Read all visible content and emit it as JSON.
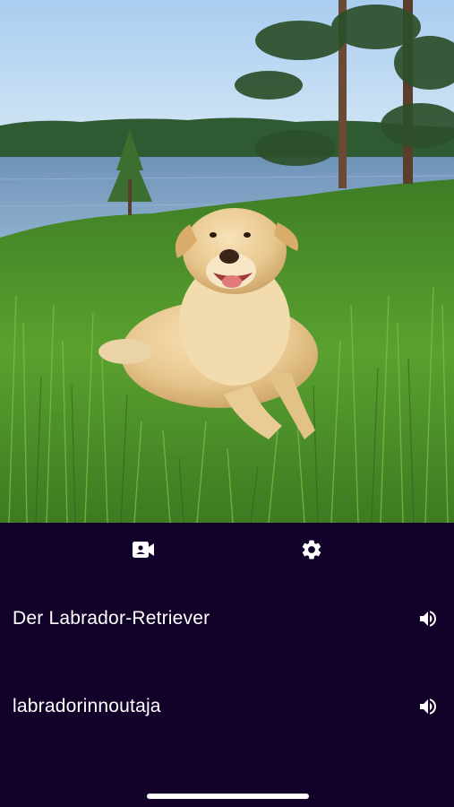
{
  "photo": {
    "subject_icon": "labrador-photo"
  },
  "toolbar": {
    "camera_icon": "video-camera-icon",
    "settings_icon": "gear-icon"
  },
  "translations": [
    {
      "text": "Der Labrador-Retriever",
      "speaker_icon": "speaker-icon"
    },
    {
      "text": "labradorinnoutaja",
      "speaker_icon": "speaker-icon"
    }
  ],
  "colors": {
    "panel_background": "#12022a",
    "text": "#ffffff"
  }
}
